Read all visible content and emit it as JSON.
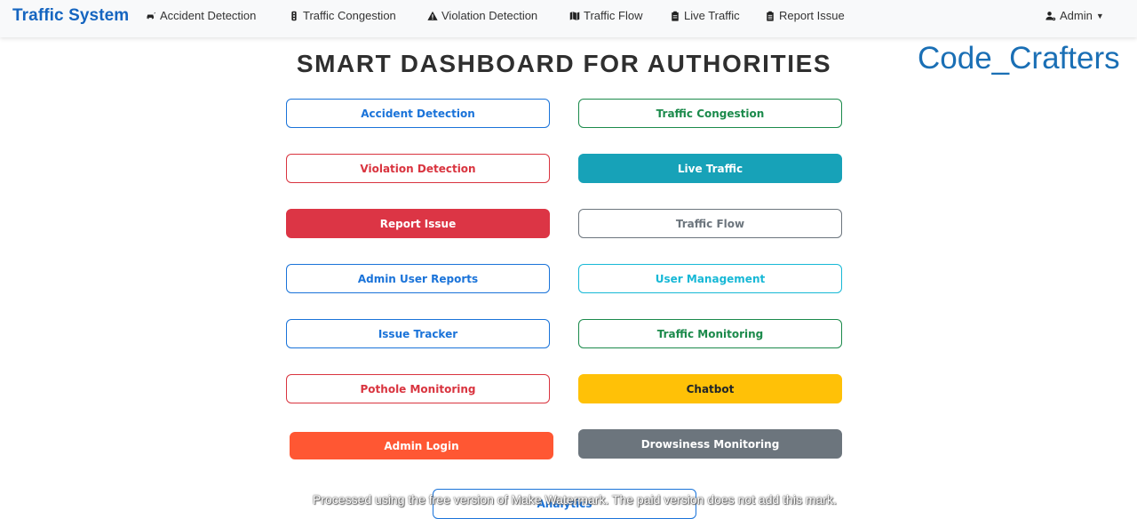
{
  "navbar": {
    "brand": "Traffic System",
    "items": [
      {
        "label": "Accident Detection",
        "icon": "car-crash-icon"
      },
      {
        "label": "Traffic Congestion",
        "icon": "traffic-light-icon"
      },
      {
        "label": "Violation Detection",
        "icon": "warning-icon"
      },
      {
        "label": "Traffic Flow",
        "icon": "map-icon"
      },
      {
        "label": "Live Traffic",
        "icon": "clipboard-icon"
      },
      {
        "label": "Report Issue",
        "icon": "clipboard-list-icon"
      }
    ],
    "user": {
      "label": "Admin",
      "icon": "user-gear-icon"
    }
  },
  "watermark": "Code_Crafters",
  "title": "SMART DASHBOARD FOR AUTHORITIES",
  "buttons": {
    "left": [
      {
        "label": "Accident Detection",
        "style": "outline-primary"
      },
      {
        "label": "Violation Detection",
        "style": "outline-danger"
      },
      {
        "label": "Report Issue",
        "style": "danger"
      },
      {
        "label": "Admin User Reports",
        "style": "outline-primary"
      },
      {
        "label": "Issue Tracker",
        "style": "outline-primary"
      },
      {
        "label": "Pothole Monitoring",
        "style": "outline-danger"
      },
      {
        "label": "Admin Login",
        "style": "orange"
      }
    ],
    "right": [
      {
        "label": "Traffic Congestion",
        "style": "outline-success"
      },
      {
        "label": "Live Traffic",
        "style": "info"
      },
      {
        "label": "Traffic Flow",
        "style": "outline-secondary"
      },
      {
        "label": "User Management",
        "style": "outline-info"
      },
      {
        "label": "Traffic Monitoring",
        "style": "outline-success"
      },
      {
        "label": "Chatbot",
        "style": "warning"
      },
      {
        "label": "Drowsiness Monitoring",
        "style": "secondary"
      }
    ],
    "bottom": {
      "label": "Analytics",
      "style": "outline-primary"
    }
  },
  "footer_note": "Processed using the free version of Make Watermark. The paid version does not add this mark.",
  "colors": {
    "brand": "#1565c0",
    "primary": "#1a73d9",
    "success": "#1b8a4b",
    "danger": "#dc3545",
    "info": "#17a2b8",
    "warning": "#ffc107",
    "secondary": "#6c757d",
    "orange": "#ff5733"
  }
}
